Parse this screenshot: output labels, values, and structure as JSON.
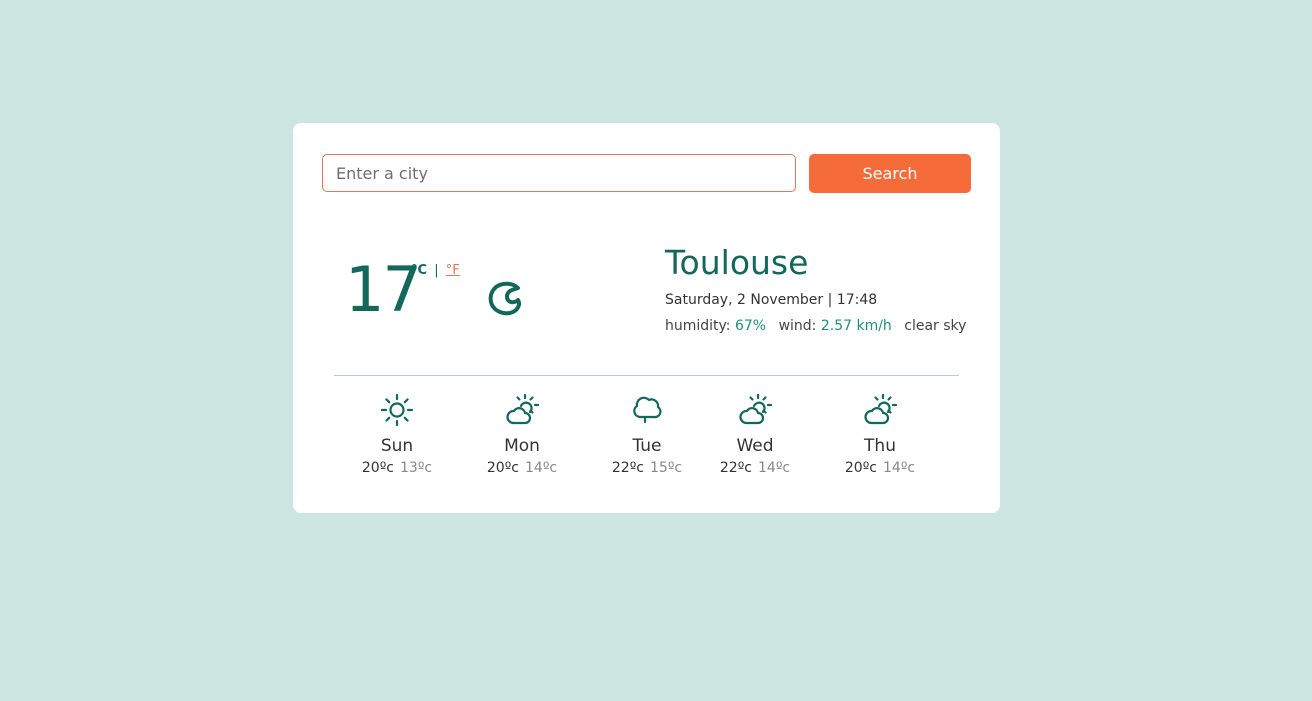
{
  "search": {
    "placeholder": "Enter a city",
    "button_label": "Search"
  },
  "current": {
    "temperature": "17",
    "unit_celsius": "°C",
    "unit_separator": "|",
    "unit_fahrenheit": "°F",
    "icon": "moon-clear-icon",
    "city": "Toulouse",
    "date_time": "Saturday, 2 November | 17:48",
    "humidity_label": "humidity:",
    "humidity_value": "67%",
    "wind_label": "wind:",
    "wind_value": "2.57 km/h",
    "description": "clear sky"
  },
  "forecast": [
    {
      "day": "Sun",
      "max": "20ºc",
      "min": "13ºc",
      "icon": "sun-icon"
    },
    {
      "day": "Mon",
      "max": "20ºc",
      "min": "14ºc",
      "icon": "partly-cloudy-icon"
    },
    {
      "day": "Tue",
      "max": "22ºc",
      "min": "15ºc",
      "icon": "cloud-icon"
    },
    {
      "day": "Wed",
      "max": "22ºc",
      "min": "14ºc",
      "icon": "partly-cloudy-icon"
    },
    {
      "day": "Thu",
      "max": "20ºc",
      "min": "14ºc",
      "icon": "partly-cloudy-icon"
    }
  ],
  "colors": {
    "background": "#cce6df",
    "accent": "#f56b3a",
    "primary": "#13685a",
    "value_text": "#1f9078"
  }
}
